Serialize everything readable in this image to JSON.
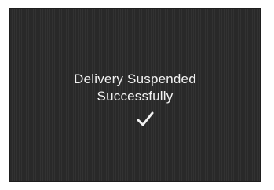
{
  "dialog": {
    "line1": "Delivery Suspended",
    "line2": "Successfully",
    "icon": "checkmark-icon"
  },
  "colors": {
    "background": "#2b2b2b",
    "text": "#f2f2f2"
  }
}
